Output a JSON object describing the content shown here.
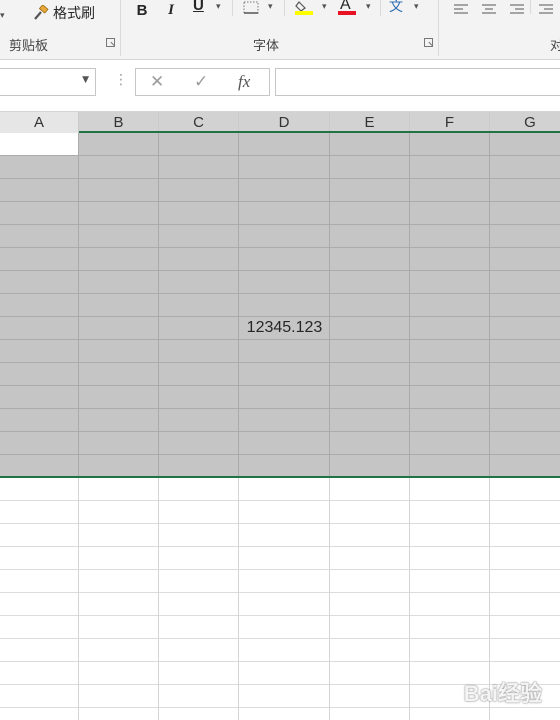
{
  "ribbon": {
    "clipboard": {
      "format_painter_label": "格式刷",
      "group_label": "剪贴板",
      "format_painter_icon": "paintbrush-icon"
    },
    "font": {
      "group_label": "字体",
      "bold_label": "B",
      "italic_label": "I",
      "underline_label": "U",
      "font_color_label": "A",
      "wen_label": "文",
      "highlight_color": "#ffff00",
      "font_color": "#e81123",
      "icons": [
        "border-icon",
        "fill-color-icon",
        "font-color-icon",
        "phonetic-guide-icon"
      ]
    },
    "alignment": {
      "group_label_partial": "对",
      "icons": [
        "align-left-icon",
        "align-center-icon",
        "align-right-icon"
      ]
    }
  },
  "formula_bar": {
    "name_box_value": "",
    "cancel_symbol": "✕",
    "enter_symbol": "✓",
    "fx_label": "fx",
    "formula_value": ""
  },
  "sheet": {
    "columns": [
      "A",
      "B",
      "C",
      "D",
      "E",
      "F",
      "G"
    ],
    "selected_columns": [
      "B",
      "C",
      "D",
      "E",
      "F",
      "G"
    ],
    "cell_value": "12345.123",
    "cell_value_column": "D",
    "selection_border_color": "#217346",
    "selection_fill_color": "#c5c5c5"
  },
  "watermark": {
    "text": "Bai经验",
    "url_text": "jingyan.baidu.com"
  }
}
